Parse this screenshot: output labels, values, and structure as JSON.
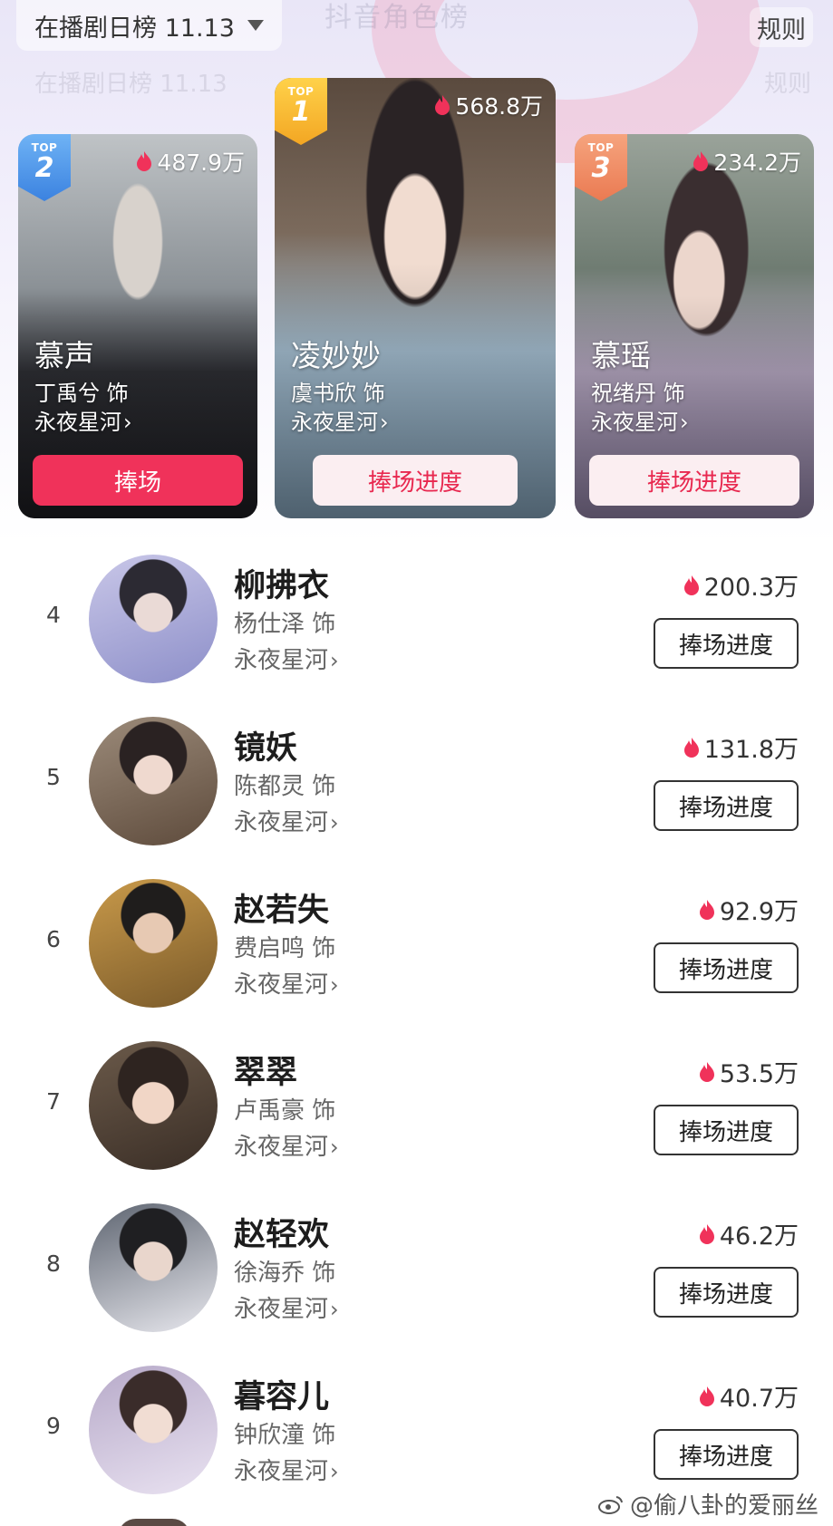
{
  "header": {
    "board_dropdown": "在播剧日榜 11.13",
    "ghost_title": "抖音角色榜",
    "rules_link": "规则"
  },
  "top3": [
    {
      "rank": "1",
      "badge_label": "TOP",
      "heat": "568.8万",
      "role": "凌妙妙",
      "actor": "虞书欣 饰",
      "drama": "永夜星河",
      "button": "捧场进度"
    },
    {
      "rank": "2",
      "badge_label": "TOP",
      "heat": "487.9万",
      "role": "慕声",
      "actor": "丁禹兮 饰",
      "drama": "永夜星河",
      "button": "捧场"
    },
    {
      "rank": "3",
      "badge_label": "TOP",
      "heat": "234.2万",
      "role": "慕瑶",
      "actor": "祝绪丹 饰",
      "drama": "永夜星河",
      "button": "捧场进度"
    }
  ],
  "list": [
    {
      "rank": "4",
      "role": "柳拂衣",
      "actor": "杨仕泽 饰",
      "drama": "永夜星河",
      "heat": "200.3万",
      "button": "捧场进度"
    },
    {
      "rank": "5",
      "role": "镜妖",
      "actor": "陈都灵 饰",
      "drama": "永夜星河",
      "heat": "131.8万",
      "button": "捧场进度"
    },
    {
      "rank": "6",
      "role": "赵若失",
      "actor": "费启鸣 饰",
      "drama": "永夜星河",
      "heat": "92.9万",
      "button": "捧场进度"
    },
    {
      "rank": "7",
      "role": "翠翠",
      "actor": "卢禹豪 饰",
      "drama": "永夜星河",
      "heat": "53.5万",
      "button": "捧场进度"
    },
    {
      "rank": "8",
      "role": "赵轻欢",
      "actor": "徐海乔 饰",
      "drama": "永夜星河",
      "heat": "46.2万",
      "button": "捧场进度"
    },
    {
      "rank": "9",
      "role": "暮容儿",
      "actor": "钟欣潼 饰",
      "drama": "永夜星河",
      "heat": "40.7万",
      "button": "捧场进度"
    }
  ],
  "watermark": "@偷八卦的爱丽丝",
  "colors": {
    "accent": "#f0325a",
    "soft_button": "#fbeef1",
    "badge_gold": "#f3a623",
    "badge_blue": "#4a90e2",
    "badge_orange": "#f08a5d"
  }
}
